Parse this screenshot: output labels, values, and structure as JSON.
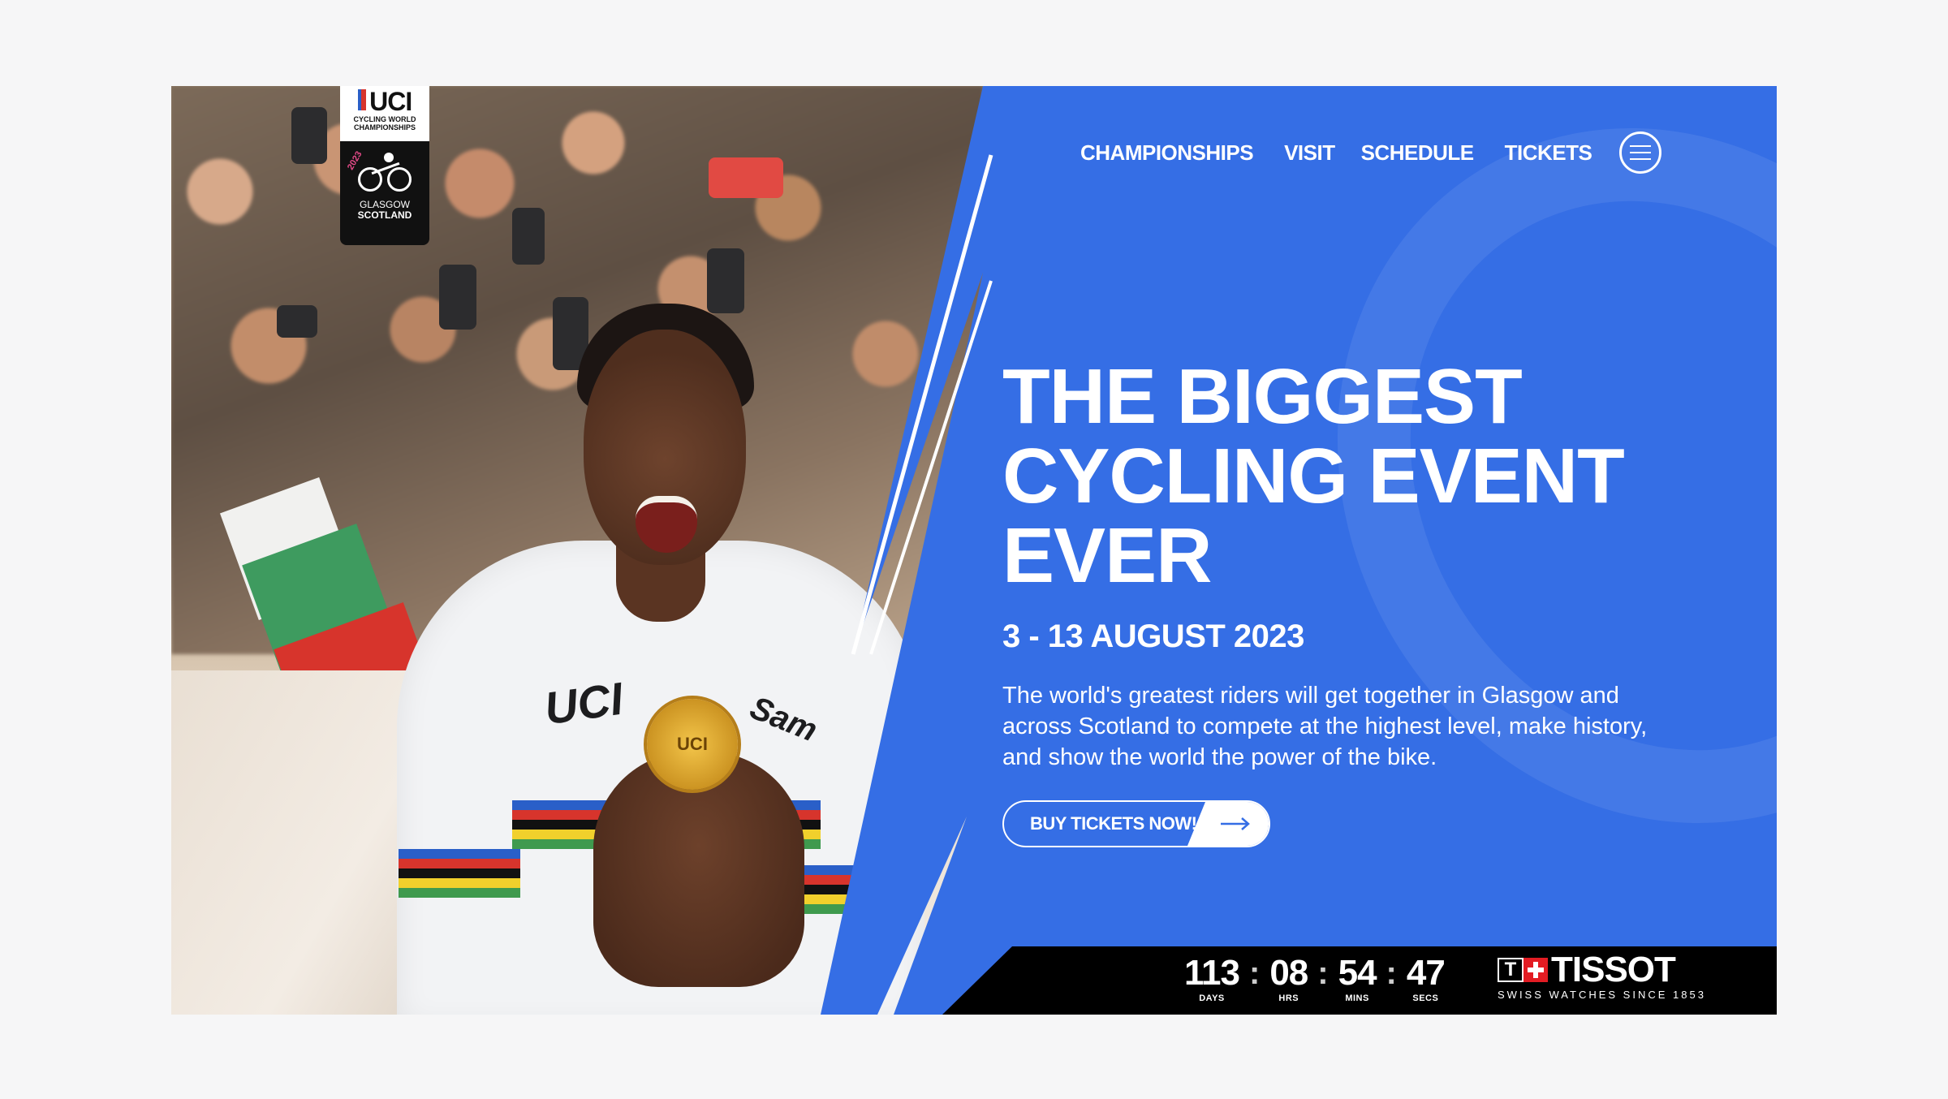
{
  "logo": {
    "brand": "UCI",
    "subtitle": "CYCLING WORLD CHAMPIONSHIPS",
    "year": "2023",
    "city_line1": "GLASGOW",
    "city_line2": "SCOTLAND"
  },
  "nav": {
    "items": [
      {
        "label": "CHAMPIONSHIPS"
      },
      {
        "label": "VISIT"
      },
      {
        "label": "SCHEDULE"
      },
      {
        "label": "TICKETS"
      }
    ],
    "menu_icon": "hamburger-menu-icon"
  },
  "hero": {
    "headline": "THE BIGGEST CYCLING EVENT EVER",
    "dates": "3 - 13 AUGUST 2023",
    "description": "The world's greatest riders will get together in Glasgow and across Scotland to compete at the highest level, make history, and show the world the power of the bike.",
    "cta_label": "BUY TICKETS NOW!",
    "cta_icon": "arrow-right-icon",
    "jersey_text_left": "UCI",
    "jersey_text_right": "Sam",
    "medal_text": "UCI"
  },
  "countdown": {
    "days": {
      "value": "113",
      "label": "DAYS"
    },
    "hours": {
      "value": "08",
      "label": "HRS"
    },
    "mins": {
      "value": "54",
      "label": "MINS"
    },
    "secs": {
      "value": "47",
      "label": "SECS"
    },
    "separator": ":"
  },
  "sponsor": {
    "name": "TISSOT",
    "tagline": "SWISS WATCHES SINCE 1853",
    "mark": "T"
  },
  "colors": {
    "brand_blue": "#356ee5",
    "bar_black": "#000000",
    "tissot_red": "#e31c23"
  }
}
